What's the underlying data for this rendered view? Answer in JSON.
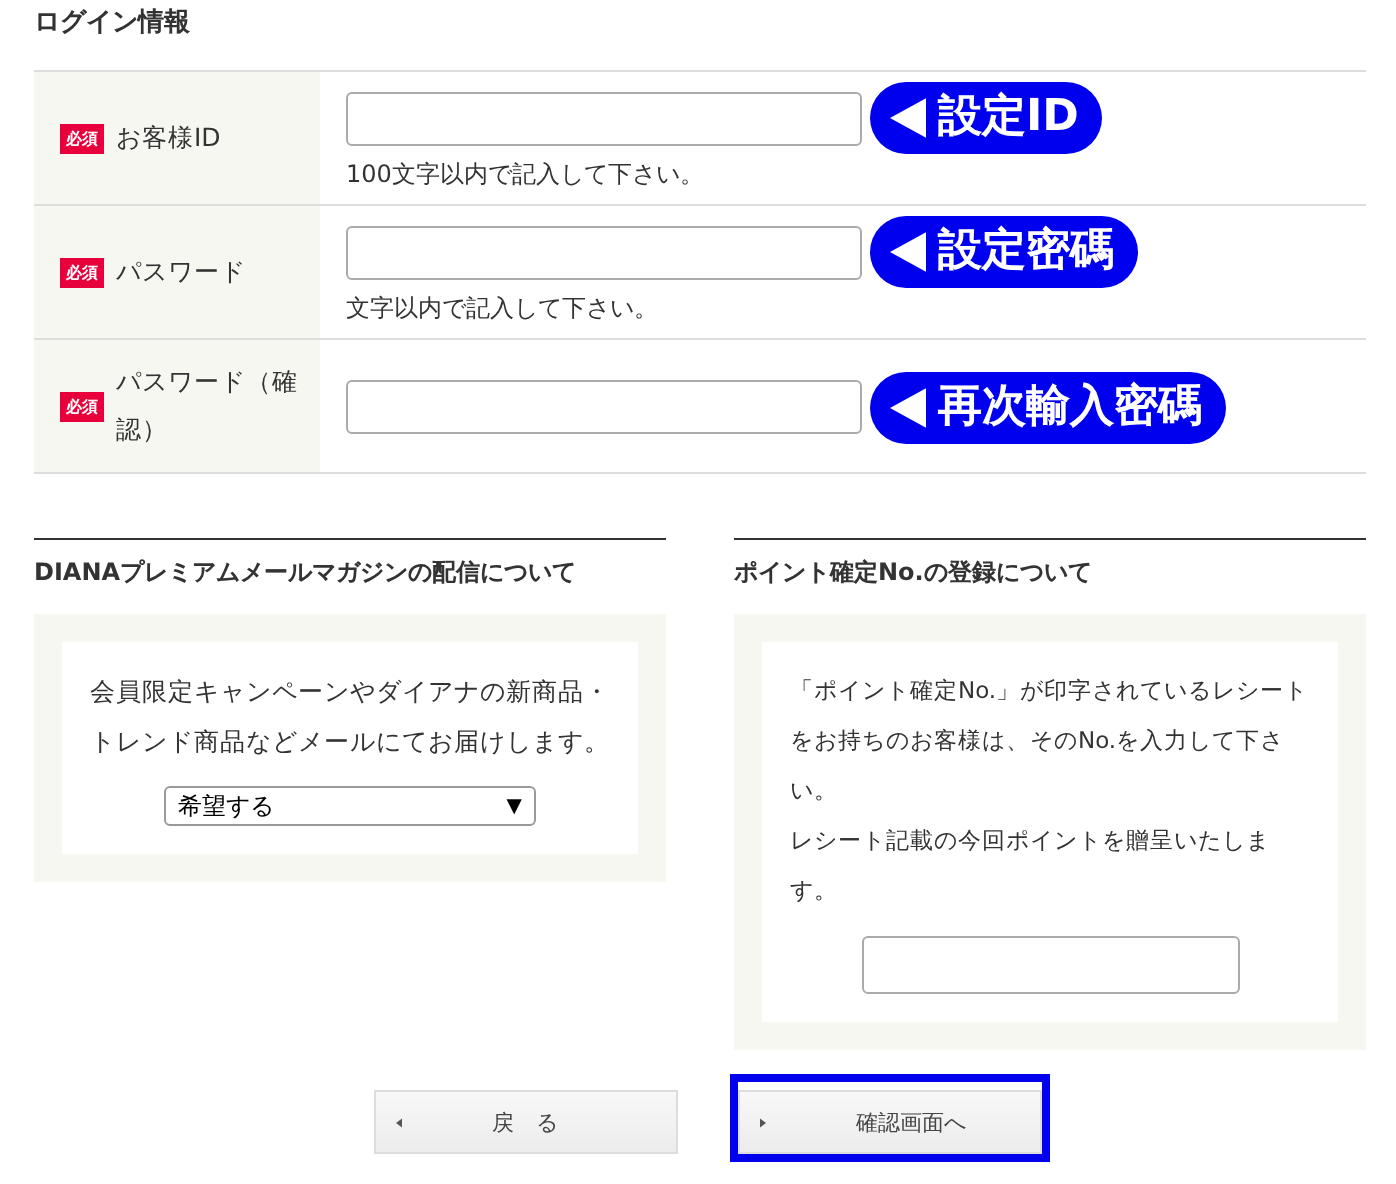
{
  "login_section": {
    "title": "ログイン情報",
    "rows": [
      {
        "required_badge": "必須",
        "label": "お客様ID",
        "callout": "設定ID",
        "hint": "100文字以内で記入して下さい。"
      },
      {
        "required_badge": "必須",
        "label": "パスワード",
        "callout": "設定密碼",
        "hint": "文字以内で記入して下さい。"
      },
      {
        "required_badge": "必須",
        "label": "パスワード（確認）",
        "callout": "再次輸入密碼"
      }
    ]
  },
  "newsletter": {
    "title": "DIANAプレミアムメールマガジンの配信について",
    "text": "会員限定キャンペーンやダイアナの新商品・トレンド商品などメールにてお届けします。",
    "select": {
      "value": "希望する",
      "arrow": "▼"
    }
  },
  "point_registration": {
    "title": "ポイント確定No.の登録について",
    "paragraphs": [
      "「ポイント確定No.」が印字されているレシートをお持ちのお客様は、そのNo.を入力して下さい。",
      "レシート記載の今回ポイントを贈呈いたします。"
    ]
  },
  "buttons": [
    {
      "label": "戻　る",
      "highlighted": false
    },
    {
      "label": "確認画面へ",
      "highlighted": true
    }
  ]
}
